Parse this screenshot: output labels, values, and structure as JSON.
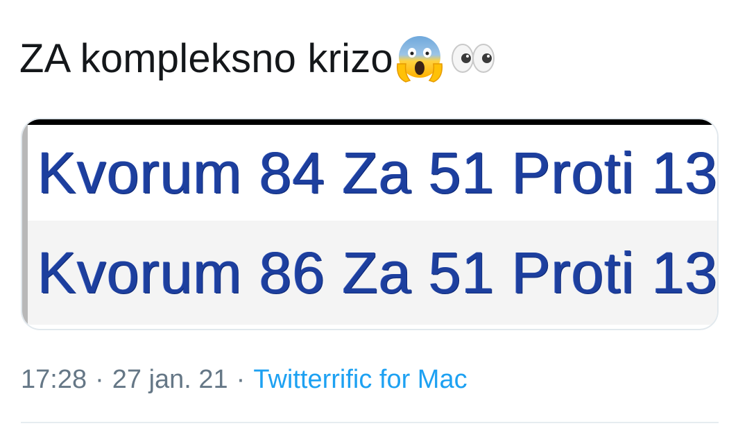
{
  "tweet": {
    "text": "ZA kompleksno krizo",
    "emojis": [
      "screaming-face-emoji",
      "eyes-emoji"
    ]
  },
  "media": {
    "rows": [
      "Kvorum 84 Za 51 Proti 13",
      "Kvorum 86 Za 51 Proti 13"
    ],
    "text_color": "#1d3f9e"
  },
  "meta": {
    "time": "17:28",
    "separator": "·",
    "date": "27 jan. 21",
    "source": "Twitterrific for Mac",
    "source_color": "#1da1f2"
  }
}
